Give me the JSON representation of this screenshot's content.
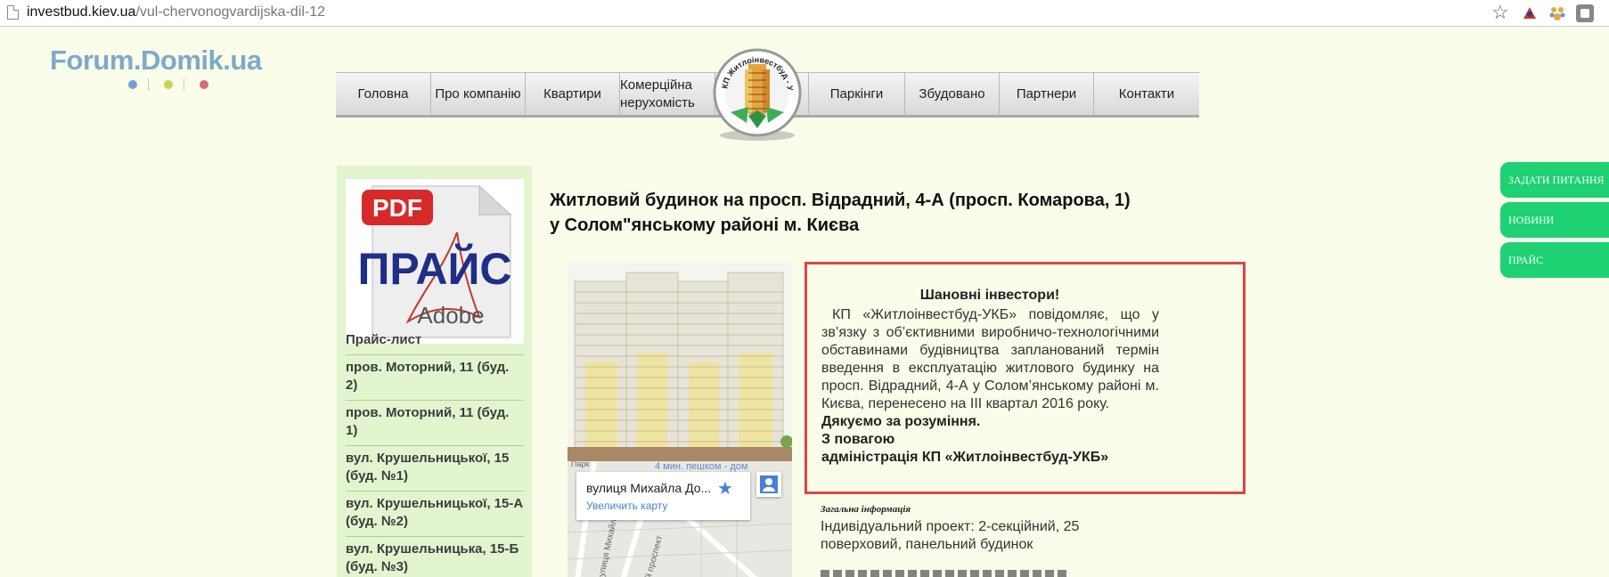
{
  "browser": {
    "url_host": "investbud.kiev.ua",
    "url_path": "/vul-chervonogvardijska-dil-12",
    "extension_icons": [
      "bookmark-star-icon",
      "extension-red-icon",
      "extension-paw-icon",
      "extension-gray-icon"
    ]
  },
  "forum_logo": {
    "text": "Forum.Domik.ua",
    "dot_colors": [
      "#6ea1d4",
      "#c8d44c",
      "#d96a7a"
    ]
  },
  "nav": {
    "items": [
      "Головна",
      "Про компанію",
      "Квартири",
      "Комерційна нерухомість",
      "Паркінги",
      "Збудовано",
      "Партнери",
      "Контакти"
    ],
    "emblem_text": "КП Житлоінвестбуд - УКБ"
  },
  "sidebar": {
    "price_badge": "PDF",
    "price_word": "ПРАЙС",
    "adobe_word": "Adobe",
    "items": [
      "Прайс-лист",
      "пров. Моторний, 11 (буд. 2)",
      "пров. Моторний, 11 (буд. 1)",
      "вул. Крушельницької, 15 (буд. №1)",
      "вул. Крушельницької, 15-А (буд. №2)",
      "вул. Крушельницька, 15-Б (буд. №3)"
    ]
  },
  "main": {
    "title_line1": "Житловий будинок на просп. Відрадний, 4-А (просп. Комарова, 1)",
    "title_line2": "у Солом\"янському районі м. Києва",
    "map": {
      "place_name": "вулиця Михайла До...",
      "enlarge_link": "Увеличить карту",
      "walk_text": "4 мин. пешком - дом",
      "street_label_1": "Парк",
      "street_label_2": "вулиця Михайла Д",
      "street_label_3": "ий проспект"
    },
    "notice": {
      "heading": "Шановні інвестори!",
      "body": "КП «Житлоінвестбуд-УКБ» повідомляє, що у зв’язку з об’єктивними виробничо-технологічними обставинами будівництва запланований термін введення в експлуатацію житлового будинку на просп. Відрадний, 4-А у Солом’янському районі м. Києва, перенесено на ІІІ квартал 2016 року.",
      "thanks": "Дякуємо за розуміння.",
      "regards": "З повагою",
      "signature": "адміністрація КП «Житлоінвестбуд-УКБ»"
    },
    "general_label": "Загальна інформація",
    "general_text": "Індивідуальний проект: 2-секційний, 25 поверховий, панельний будинок"
  },
  "side_tabs": [
    "ЗАДАТИ ПИТАННЯ",
    "НОВИНИ",
    "ПРАЙС"
  ],
  "colors": {
    "page_bg": "#f9fde9",
    "sidebar_bg": "#e2f5cf",
    "notice_border": "#e04444",
    "side_tab": "#1ed173",
    "logo_blue": "#7eaac9"
  }
}
